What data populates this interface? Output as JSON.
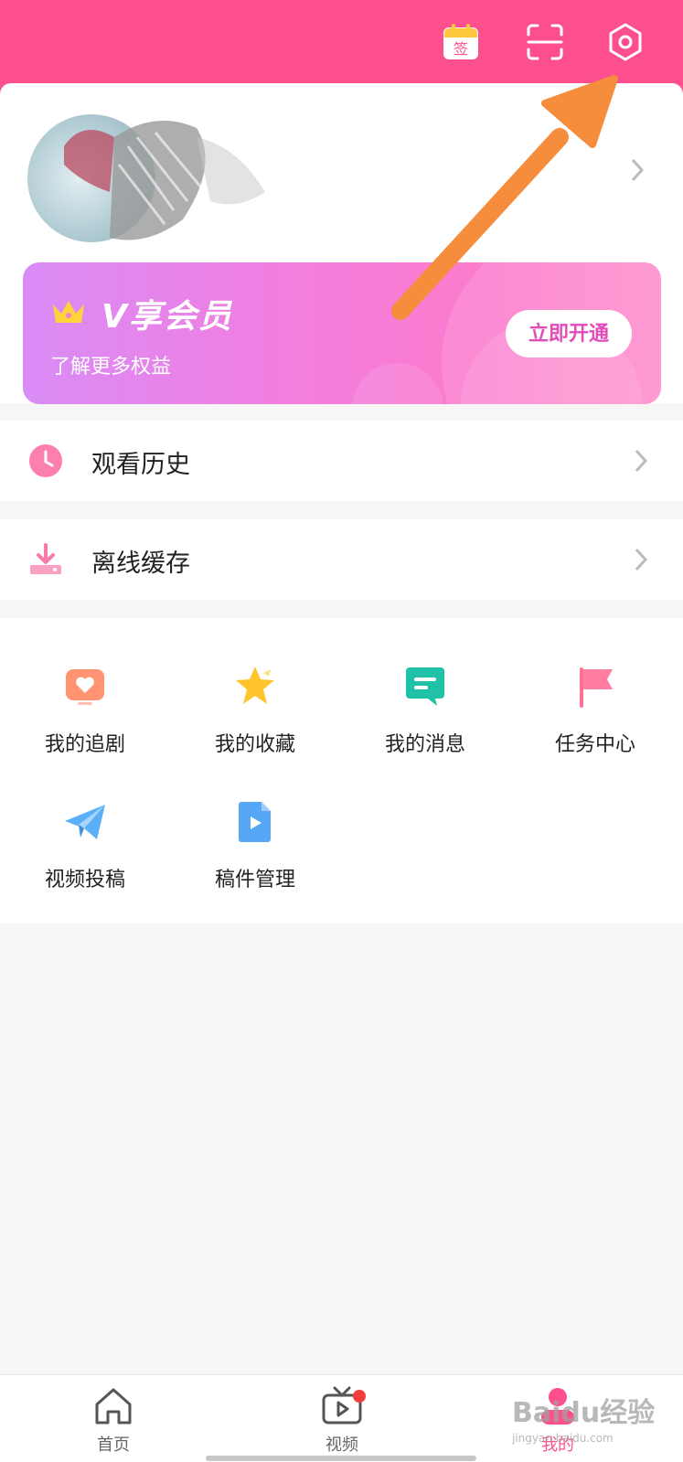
{
  "header": {
    "checkin_icon_text": "签",
    "icons": [
      "calendar-checkin-icon",
      "scan-icon",
      "settings-icon"
    ],
    "colors": {
      "bar": "#fd4f8d"
    }
  },
  "vip": {
    "title": "V享会员",
    "subtitle": "了解更多权益",
    "button_label": "立即开通",
    "icon": "crown-icon"
  },
  "rows": [
    {
      "label": "观看历史",
      "icon": "clock-icon"
    },
    {
      "label": "离线缓存",
      "icon": "download-icon"
    }
  ],
  "grid": [
    {
      "label": "我的追剧",
      "icon": "tv-heart-icon"
    },
    {
      "label": "我的收藏",
      "icon": "star-icon"
    },
    {
      "label": "我的消息",
      "icon": "message-icon"
    },
    {
      "label": "任务中心",
      "icon": "flag-icon"
    },
    {
      "label": "视频投稿",
      "icon": "paper-plane-icon"
    },
    {
      "label": "稿件管理",
      "icon": "video-file-icon"
    }
  ],
  "tabbar": {
    "items": [
      {
        "label": "首页",
        "icon": "home-icon"
      },
      {
        "label": "视频",
        "icon": "video-tv-icon",
        "badge": true
      },
      {
        "label": "我的",
        "icon": "profile-icon",
        "active": true
      }
    ],
    "accent": "#fd4f8d"
  },
  "watermark": {
    "text": "Baidu经验",
    "sub": "jingyan.baidu.com"
  }
}
